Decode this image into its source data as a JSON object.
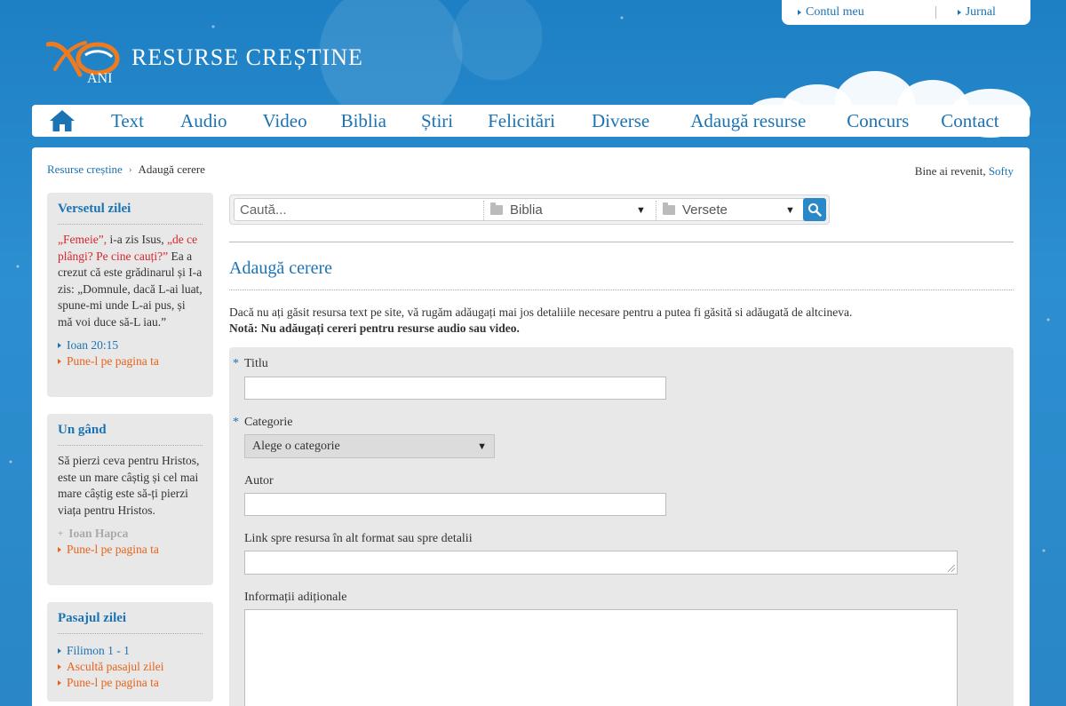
{
  "logo": {
    "title": "RESURSE CREȘTINE",
    "badge": "ANI"
  },
  "userbar": {
    "account": "Contul meu",
    "journal": "Jurnal"
  },
  "nav": {
    "home_icon": "home-icon",
    "items": [
      "Text",
      "Audio",
      "Video",
      "Biblia",
      "Știri",
      "Felicitări",
      "Diverse",
      "Adaugă resurse",
      "Concurs",
      "Contact"
    ]
  },
  "breadcrumb": {
    "home": "Resurse creștine",
    "current": "Adaugă cerere"
  },
  "welcome": {
    "text": "Bine ai revenit,",
    "user": "Softy"
  },
  "sidebar": {
    "verse": {
      "title": "Versetul zilei",
      "part1": "„Femeie”,",
      "part2": " i-a zis Isus, ",
      "part3": "„de ce plângi? Pe cine cauți?”",
      "part4": " Ea a crezut că este grădinarul și I-a zis: „Domnule, dacă L-ai luat, spune-mi unde L-ai pus, și mă voi duce să-L iau.”",
      "ref": "Ioan 20:15",
      "share": "Pune-l pe pagina ta"
    },
    "thought": {
      "title": "Un gând",
      "text": "Să pierzi ceva pentru Hristos, este un mare câștig și cel mai mare câștig este să-ți pierzi viața pentru Hristos.",
      "author": "Ioan Hapca",
      "share": "Pune-l pe pagina ta"
    },
    "passage": {
      "title": "Pasajul zilei",
      "ref": "Filimon 1 - 1",
      "listen": "Ascultă pasajul zilei",
      "share": "Pune-l pe pagina ta"
    }
  },
  "search": {
    "placeholder": "Caută...",
    "scope": "Biblia",
    "type": "Versete"
  },
  "page": {
    "title": "Adaugă cerere",
    "intro": "Dacă nu ați găsit resursa text pe site, vă rugăm adăugați mai jos detaliile necesare pentru a putea fi găsită si adăugată de altcineva.",
    "note": "Notă: Nu adăugați cereri pentru resurse audio sau video."
  },
  "form": {
    "required_mark": "*",
    "title_label": "Titlu",
    "category_label": "Categorie",
    "category_value": "Alege o categorie",
    "author_label": "Autor",
    "link_label": "Link spre resursa în alt format sau spre detalii",
    "info_label": "Informații adiționale"
  },
  "colors": {
    "brand_blue": "#1b73b4",
    "orange": "#e8621a",
    "red": "#d6262b",
    "sky": "#2b86c4"
  }
}
